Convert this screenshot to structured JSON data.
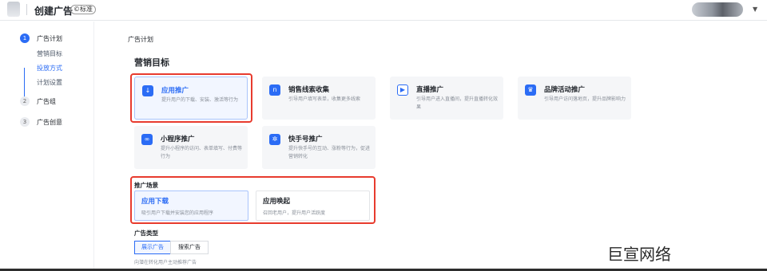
{
  "header": {
    "title": "创建广告",
    "badge": "©标准"
  },
  "sidebar": {
    "steps": [
      {
        "num": "1",
        "label": "广告计划"
      },
      {
        "num": "2",
        "label": "广告组"
      },
      {
        "num": "3",
        "label": "广告创意"
      }
    ],
    "sub_items": [
      "营销目标",
      "投放方式",
      "计划设置"
    ]
  },
  "main": {
    "section_title": "广告计划",
    "goal_title": "营销目标",
    "goals": [
      {
        "title": "应用推广",
        "desc": "提升用户的下载、安装、激活等行为",
        "icon": "download-icon"
      },
      {
        "title": "销售线索收集",
        "desc": "引导用户填写表单，收集更多线索",
        "icon": "form-icon"
      },
      {
        "title": "直播推广",
        "desc": "引导用户进入直播间，提升直播转化效果",
        "icon": "live-icon"
      },
      {
        "title": "品牌活动推广",
        "desc": "引导用户访问落地页，提升品牌影响力",
        "icon": "brand-icon"
      },
      {
        "title": "小程序推广",
        "desc": "提升小程序的访问、表单填写、付费等行为",
        "icon": "miniprogram-icon"
      },
      {
        "title": "快手号推广",
        "desc": "提升快手号的互动、涨粉等行为，促进营销转化",
        "icon": "kuaishou-icon"
      }
    ],
    "scene_label": "推广场景",
    "scenes": [
      {
        "title": "应用下载",
        "desc": "吸引用户下载并安装您的应用程序"
      },
      {
        "title": "应用唤起",
        "desc": "召回老用户，提升用户活跃度"
      }
    ],
    "ad_type_label": "广告类型",
    "ad_types": [
      "展示广告",
      "搜索广告"
    ],
    "ad_type_hint": "向潜在转化用户主动推荐广告"
  },
  "watermark": "巨宣网络",
  "colors": {
    "accent": "#2b6cf5",
    "highlight_border": "#e83b2e"
  }
}
